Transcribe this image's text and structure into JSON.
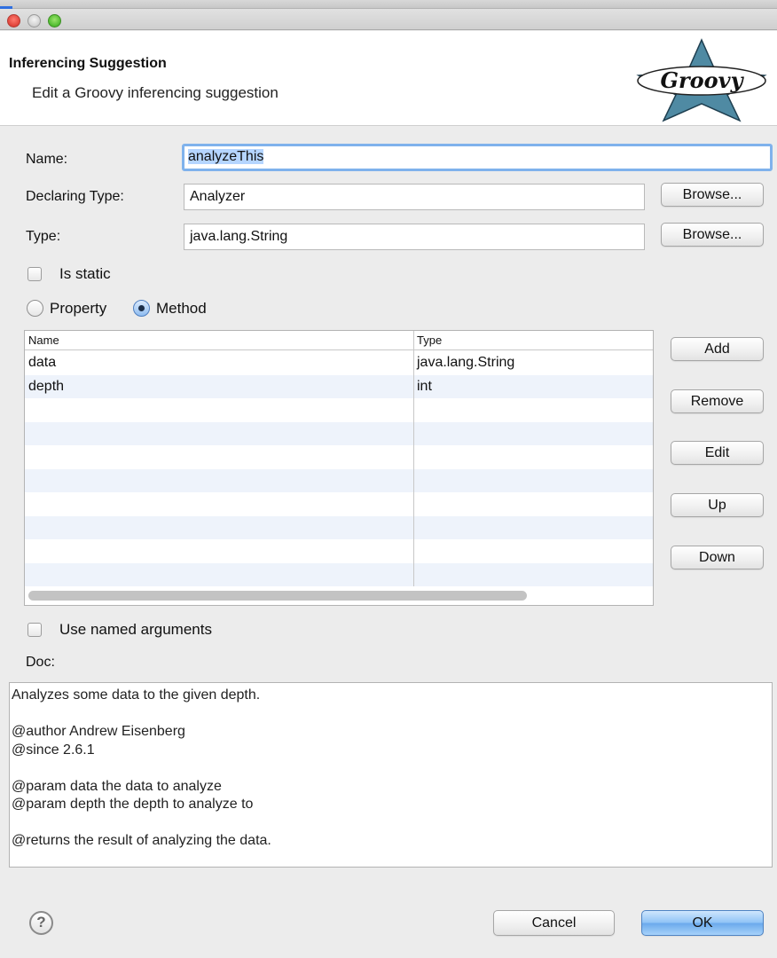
{
  "window": {
    "close_label": "",
    "app_title": ""
  },
  "header": {
    "title": "Inferencing Suggestion",
    "subtitle": "Edit a Groovy inferencing suggestion",
    "logo_text": "Groovy"
  },
  "form": {
    "name_label": "Name:",
    "name_value": "analyzeThis",
    "declaring_type_label": "Declaring Type:",
    "declaring_type_value": "Analyzer",
    "type_label": "Type:",
    "type_value": "java.lang.String",
    "browse_label": "Browse...",
    "is_static_label": "Is static",
    "is_static_checked": false,
    "kind_options": [
      {
        "label": "Property",
        "selected": false
      },
      {
        "label": "Method",
        "selected": true
      }
    ]
  },
  "params_table": {
    "columns": [
      "Name",
      "Type"
    ],
    "rows": [
      {
        "name": "data",
        "type": "java.lang.String"
      },
      {
        "name": "depth",
        "type": "int"
      }
    ]
  },
  "side_buttons": {
    "add": "Add",
    "remove": "Remove",
    "edit": "Edit",
    "up": "Up",
    "down": "Down"
  },
  "named_args": {
    "label": "Use named arguments",
    "checked": false
  },
  "doc": {
    "label": "Doc:",
    "text": "Analyzes some data to the given depth.\n\n@author Andrew Eisenberg\n@since 2.6.1\n\n@param data the data to analyze\n@param depth the depth to analyze to\n\n@returns the result of analyzing the data."
  },
  "footer": {
    "help_label": "?",
    "cancel_label": "Cancel",
    "ok_label": "OK"
  },
  "colors": {
    "accent": "#7fb2ec",
    "logo_star": "#4f8aa3",
    "primary_button": "#8ec2f6"
  },
  "icons": {
    "help": "question-mark-icon",
    "logo": "groovy-star-logo"
  }
}
